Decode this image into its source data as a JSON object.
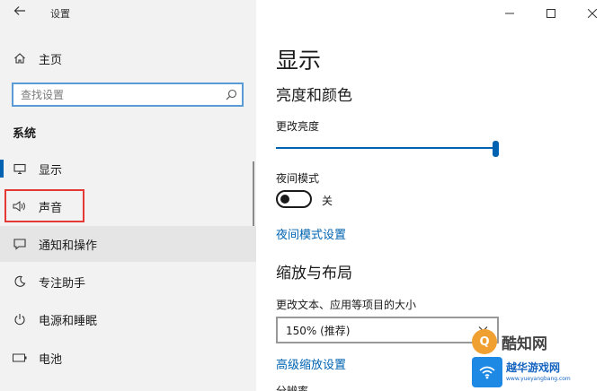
{
  "window": {
    "title": "设置"
  },
  "sidebar": {
    "home_label": "主页",
    "search_placeholder": "查找设置",
    "section_heading": "系统",
    "items": [
      {
        "label": "显示",
        "icon": "monitor-icon"
      },
      {
        "label": "声音",
        "icon": "speaker-icon"
      },
      {
        "label": "通知和操作",
        "icon": "notification-icon"
      },
      {
        "label": "专注助手",
        "icon": "moon-icon"
      },
      {
        "label": "电源和睡眠",
        "icon": "power-icon"
      },
      {
        "label": "电池",
        "icon": "battery-icon"
      }
    ]
  },
  "main": {
    "page_title": "显示",
    "brightness_section": "亮度和颜色",
    "brightness_label": "更改亮度",
    "brightness_value": 1.0,
    "night_mode_label": "夜间模式",
    "night_mode_state": "关",
    "night_mode_on": false,
    "night_mode_settings_link": "夜间模式设置",
    "scale_section": "缩放与布局",
    "scale_label": "更改文本、应用等项目的大小",
    "scale_value": "150% (推荐)",
    "advanced_scale_link": "高级缩放设置",
    "truncated_label": "分辨率"
  },
  "watermarks": {
    "brand1": "酷知网",
    "brand1_logo": "Q",
    "brand2": "越华游戏网",
    "brand2_url": "www.yueyangbang.com"
  },
  "colors": {
    "accent": "#0063b1",
    "sidebar_bg": "#f2f2f2",
    "highlight_border": "#e53935",
    "search_border": "#5b9bd5"
  }
}
